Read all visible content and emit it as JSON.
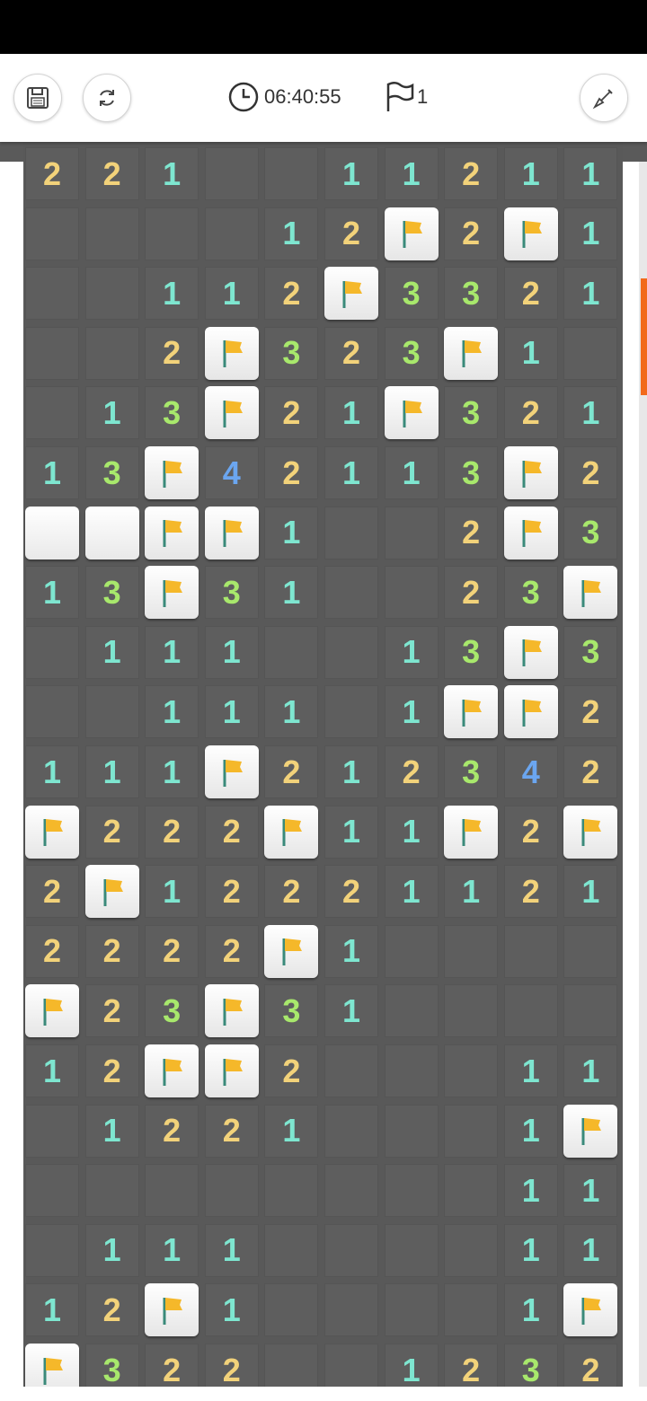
{
  "toolbar": {
    "save_icon": "floppy-disk-icon",
    "restart_icon": "refresh-icon",
    "timer_icon": "clock-icon",
    "timer_value": "06:40:55",
    "flag_icon": "flag-outline-icon",
    "flag_count": "1",
    "dig_icon": "shovel-icon"
  },
  "colors": {
    "1": "#7ee6d0",
    "2": "#f2d27a",
    "3": "#a8e86c",
    "4": "#6ba6f0",
    "flag": "#f5b82a",
    "pole": "#3a8a7a",
    "scroll_thumb": "#f26a1b"
  },
  "board": {
    "legend": "digit=number, .=open empty, F=flag, H=unrevealed",
    "rows": [
      "2 2 1 . . 1 1 2 1 1",
      ". . . . 1 2 F 2 F 1",
      ". . 1 1 2 F 3 3 2 1",
      ". . 2 F 3 2 3 F 1 .",
      ". 1 3 F 2 1 F 3 2 1",
      "1 3 F 4 2 1 1 3 F 2",
      "H H F F 1 . . 2 F 3",
      "1 3 F 3 1 . . 2 3 F",
      ". 1 1 1 . . 1 3 F 3",
      ". . 1 1 1 . 1 F F 2",
      "1 1 1 F 2 1 2 3 4 2",
      "F 2 2 2 F 1 1 F 2 F",
      "2 F 1 2 2 2 1 1 2 1",
      "2 2 2 2 F 1 . . . .",
      "F 2 3 F 3 1 . . . .",
      "1 2 F F 2 . . . 1 1",
      ". 1 2 2 1 . . . 1 F",
      ". . . . . . . . 1 1",
      ". 1 1 1 . . . . 1 1",
      "1 2 F 1 . . . . 1 F",
      "F 3 2 2 . . 1 2 3 2"
    ]
  }
}
